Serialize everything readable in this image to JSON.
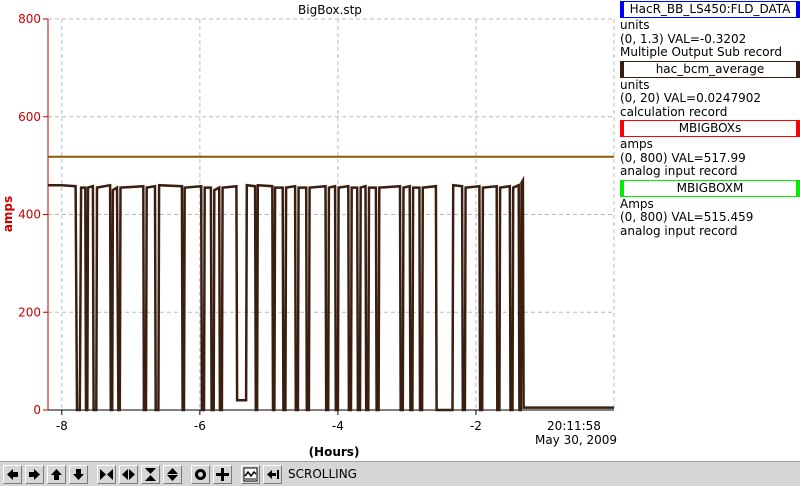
{
  "chart_data": {
    "type": "line",
    "title": "BigBox.stp",
    "xlabel": "(Hours)",
    "ylabel": "amps",
    "xlim": [
      -8.2,
      0
    ],
    "ylim": [
      0,
      800
    ],
    "x_ticks": [
      -8,
      -6,
      -4,
      -2
    ],
    "y_ticks": [
      0,
      200,
      400,
      600,
      800
    ],
    "grid": true,
    "end_time": "20:11:58",
    "end_date": "May 30, 2009",
    "series": [
      {
        "name": "MBIGBOXs",
        "color": "#3a1f10",
        "points": [
          [
            -8.2,
            460
          ],
          [
            -8.0,
            460
          ],
          [
            -7.8,
            458
          ],
          [
            -7.78,
            0
          ],
          [
            -7.74,
            0
          ],
          [
            -7.72,
            455
          ],
          [
            -7.66,
            455
          ],
          [
            -7.65,
            0
          ],
          [
            -7.63,
            0
          ],
          [
            -7.62,
            455
          ],
          [
            -7.55,
            458
          ],
          [
            -7.54,
            0
          ],
          [
            -7.5,
            0
          ],
          [
            -7.49,
            455
          ],
          [
            -7.3,
            460
          ],
          [
            -7.29,
            0
          ],
          [
            -7.27,
            0
          ],
          [
            -7.26,
            450
          ],
          [
            -7.2,
            455
          ],
          [
            -7.18,
            0
          ],
          [
            -7.16,
            0
          ],
          [
            -7.15,
            455
          ],
          [
            -6.82,
            458
          ],
          [
            -6.81,
            0
          ],
          [
            -6.78,
            0
          ],
          [
            -6.77,
            455
          ],
          [
            -6.65,
            458
          ],
          [
            -6.64,
            0
          ],
          [
            -6.6,
            0
          ],
          [
            -6.59,
            460
          ],
          [
            -6.26,
            458
          ],
          [
            -6.25,
            0
          ],
          [
            -6.23,
            0
          ],
          [
            -6.22,
            455
          ],
          [
            -5.98,
            458
          ],
          [
            -5.97,
            0
          ],
          [
            -5.94,
            0
          ],
          [
            -5.93,
            455
          ],
          [
            -5.84,
            455
          ],
          [
            -5.83,
            0
          ],
          [
            -5.8,
            0
          ],
          [
            -5.79,
            450
          ],
          [
            -5.72,
            455
          ],
          [
            -5.71,
            0
          ],
          [
            -5.68,
            0
          ],
          [
            -5.67,
            455
          ],
          [
            -5.47,
            458
          ],
          [
            -5.46,
            20
          ],
          [
            -5.33,
            20
          ],
          [
            -5.32,
            460
          ],
          [
            -5.2,
            458
          ],
          [
            -5.19,
            0
          ],
          [
            -5.17,
            0
          ],
          [
            -5.16,
            460
          ],
          [
            -4.95,
            458
          ],
          [
            -4.94,
            0
          ],
          [
            -4.92,
            0
          ],
          [
            -4.91,
            455
          ],
          [
            -4.8,
            455
          ],
          [
            -4.79,
            0
          ],
          [
            -4.76,
            0
          ],
          [
            -4.75,
            455
          ],
          [
            -4.62,
            458
          ],
          [
            -4.61,
            0
          ],
          [
            -4.58,
            0
          ],
          [
            -4.57,
            455
          ],
          [
            -4.46,
            455
          ],
          [
            -4.45,
            0
          ],
          [
            -4.42,
            0
          ],
          [
            -4.41,
            455
          ],
          [
            -4.18,
            458
          ],
          [
            -4.17,
            0
          ],
          [
            -4.14,
            0
          ],
          [
            -4.13,
            455
          ],
          [
            -4.04,
            458
          ],
          [
            -4.03,
            0
          ],
          [
            -4.0,
            0
          ],
          [
            -3.99,
            455
          ],
          [
            -3.85,
            458
          ],
          [
            -3.84,
            0
          ],
          [
            -3.81,
            0
          ],
          [
            -3.8,
            455
          ],
          [
            -3.72,
            455
          ],
          [
            -3.71,
            0
          ],
          [
            -3.68,
            0
          ],
          [
            -3.67,
            455
          ],
          [
            -3.6,
            458
          ],
          [
            -3.59,
            0
          ],
          [
            -3.56,
            0
          ],
          [
            -3.55,
            455
          ],
          [
            -3.45,
            455
          ],
          [
            -3.44,
            0
          ],
          [
            -3.41,
            0
          ],
          [
            -3.4,
            455
          ],
          [
            -3.1,
            458
          ],
          [
            -3.09,
            0
          ],
          [
            -3.06,
            0
          ],
          [
            -3.05,
            455
          ],
          [
            -2.96,
            458
          ],
          [
            -2.95,
            0
          ],
          [
            -2.92,
            0
          ],
          [
            -2.91,
            455
          ],
          [
            -2.82,
            455
          ],
          [
            -2.81,
            0
          ],
          [
            -2.78,
            0
          ],
          [
            -2.77,
            455
          ],
          [
            -2.58,
            458
          ],
          [
            -2.57,
            0
          ],
          [
            -2.34,
            0
          ],
          [
            -2.33,
            460
          ],
          [
            -2.2,
            458
          ],
          [
            -2.19,
            0
          ],
          [
            -2.16,
            0
          ],
          [
            -2.15,
            455
          ],
          [
            -1.95,
            458
          ],
          [
            -1.94,
            0
          ],
          [
            -1.91,
            0
          ],
          [
            -1.9,
            455
          ],
          [
            -1.7,
            458
          ],
          [
            -1.69,
            0
          ],
          [
            -1.66,
            0
          ],
          [
            -1.65,
            455
          ],
          [
            -1.51,
            458
          ],
          [
            -1.5,
            0
          ],
          [
            -1.47,
            0
          ],
          [
            -1.46,
            455
          ],
          [
            -1.38,
            460
          ],
          [
            -1.37,
            0
          ],
          [
            -1.35,
            0
          ],
          [
            -1.34,
            465
          ],
          [
            -1.32,
            470
          ],
          [
            -1.31,
            5
          ],
          [
            0,
            5
          ]
        ]
      },
      {
        "name": "MBIGBOXM",
        "color": "#8a5a00",
        "points": [
          [
            -8.2,
            518
          ],
          [
            0,
            518
          ]
        ]
      }
    ],
    "legend_placement": "right"
  },
  "legend": {
    "items": [
      {
        "name": "HacR_BB_LS450:FLD_DATA",
        "color": "#0000ff",
        "units": "units",
        "range": "(0, 1.3) VAL=-0.3202",
        "type": "Multiple Output Sub record"
      },
      {
        "name": "hac_bcm_average",
        "color": "#3a1f10",
        "units": "units",
        "range": "(0, 20) VAL=0.0247902",
        "type": "calculation record"
      },
      {
        "name": "MBIGBOXs",
        "color": "#ff0000",
        "units": "amps",
        "range": "(0, 800) VAL=517.99",
        "type": "analog input record"
      },
      {
        "name": "MBIGBOXM",
        "color": "#00ee00",
        "units": "Amps",
        "range": "(0, 800) VAL=515.459",
        "type": "analog input record"
      }
    ]
  },
  "toolbar": {
    "buttons": [
      {
        "icon": "arrow-left-icon"
      },
      {
        "icon": "arrow-right-icon"
      },
      {
        "icon": "arrow-up-icon"
      },
      {
        "icon": "arrow-down-icon"
      },
      {
        "icon": "zoom-in-horizontal-icon"
      },
      {
        "icon": "zoom-out-horizontal-icon"
      },
      {
        "icon": "zoom-in-vertical-icon"
      },
      {
        "icon": "zoom-out-vertical-icon"
      },
      {
        "icon": "auto-scale-icon"
      },
      {
        "icon": "crosshair-icon"
      },
      {
        "icon": "trend-icon"
      },
      {
        "icon": "scroll-to-end-icon"
      }
    ],
    "status": "SCROLLING"
  },
  "colors": {
    "axis_red": "#cc0000",
    "grid": "#bbbbbb"
  }
}
